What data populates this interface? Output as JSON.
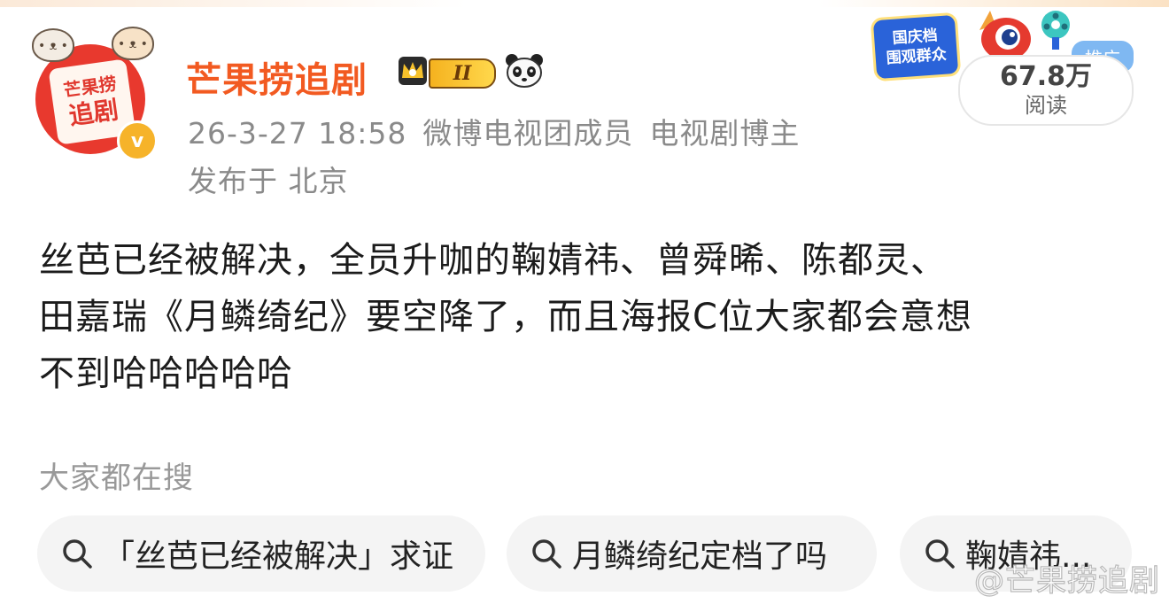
{
  "author": {
    "name": "芒果捞追剧",
    "avatar_text_line1": "芒果捞",
    "avatar_text_line2": "追剧",
    "level_badge": "II",
    "verified_mark": "v",
    "timestamp": "26-3-27 18:58",
    "tag1": "微博电视团成员",
    "tag2": "电视剧博主",
    "location": "发布于 北京"
  },
  "promo": {
    "badge_line1": "国庆档",
    "badge_line2": "围观群众",
    "ad_label": "推广",
    "read_count": "67.8万",
    "read_label": "阅读"
  },
  "post": {
    "lines": [
      "丝芭已经被解决，全员升咖的鞠婧祎、曾舜晞、陈都灵、",
      "田嘉瑞《月鳞绮纪》要空降了，而且海报C位大家都会意想",
      "不到哈哈哈哈哈"
    ]
  },
  "search": {
    "title": "大家都在搜",
    "chips": [
      "「丝芭已经被解决」求证",
      "月鳞绮纪定档了吗",
      "鞠婧祎..."
    ]
  },
  "watermark": "@芒果捞追剧",
  "colors": {
    "name": "#f25a21",
    "avatar_bg": "#e8392e",
    "verified": "#f6b32a",
    "meta": "#8a8a8a",
    "chip_bg": "#f4f4f4",
    "ad_tag": "#7fb8f2"
  },
  "icons": [
    "crown-icon",
    "panda-icon",
    "verified-icon",
    "search-icon",
    "weibo-eye-icon",
    "film-icon"
  ]
}
